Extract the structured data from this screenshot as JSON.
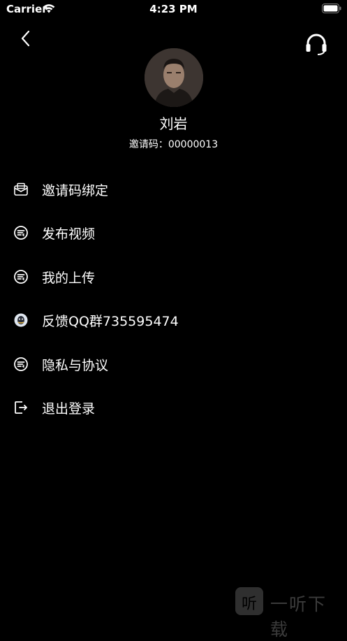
{
  "status_bar": {
    "carrier": "Carrier",
    "time": "4:23 PM"
  },
  "header": {
    "back_icon": "chevron-left-icon",
    "support_icon": "headset-icon"
  },
  "profile": {
    "name": "刘岩",
    "invite_label": "邀请码：",
    "invite_code": "00000013"
  },
  "menu": [
    {
      "label": "邀请码绑定",
      "icon": "envelope-icon"
    },
    {
      "label": "发布视频",
      "icon": "video-icon"
    },
    {
      "label": "我的上传",
      "icon": "upload-icon"
    },
    {
      "label": "反馈QQ群735595474",
      "icon": "qq-icon"
    },
    {
      "label": "隐私与协议",
      "icon": "document-icon"
    },
    {
      "label": "退出登录",
      "icon": "logout-icon"
    }
  ],
  "watermark": {
    "logo_char": "听",
    "text": "一听下载"
  },
  "colors": {
    "background": "#000000",
    "text": "#ffffff"
  }
}
